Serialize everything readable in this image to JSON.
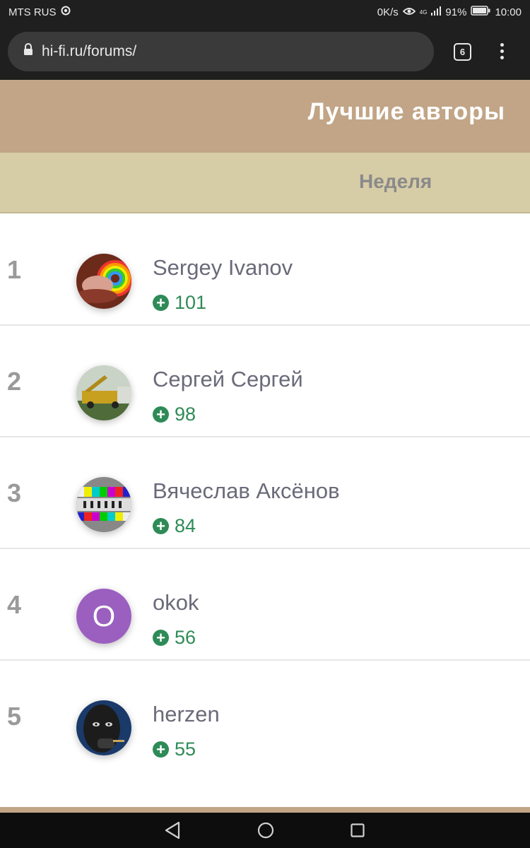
{
  "statusbar": {
    "carrier": "MTS RUS",
    "speed": "0K/s",
    "network": "4G",
    "battery": "91%",
    "time": "10:00"
  },
  "browser": {
    "url": "hi-fi.ru/forums/",
    "tab_count": "6"
  },
  "widget": {
    "title": "Лучшие авторы",
    "period_label": "Неделя"
  },
  "authors": [
    {
      "rank": "1",
      "name": "Sergey Ivanov",
      "score": "101",
      "avatar": "image"
    },
    {
      "rank": "2",
      "name": "Сергей Сергей",
      "score": "98",
      "avatar": "image"
    },
    {
      "rank": "3",
      "name": "Вячеслав Аксёнов",
      "score": "84",
      "avatar": "image"
    },
    {
      "rank": "4",
      "name": "okok",
      "score": "56",
      "avatar_letter": "O",
      "avatar_color": "#9b5fc0"
    },
    {
      "rank": "5",
      "name": "herzen",
      "score": "55",
      "avatar": "image"
    }
  ],
  "colors": {
    "header_bg": "#c1a586",
    "subheader_bg": "#d6cca6",
    "score_green": "#2e8b57"
  }
}
